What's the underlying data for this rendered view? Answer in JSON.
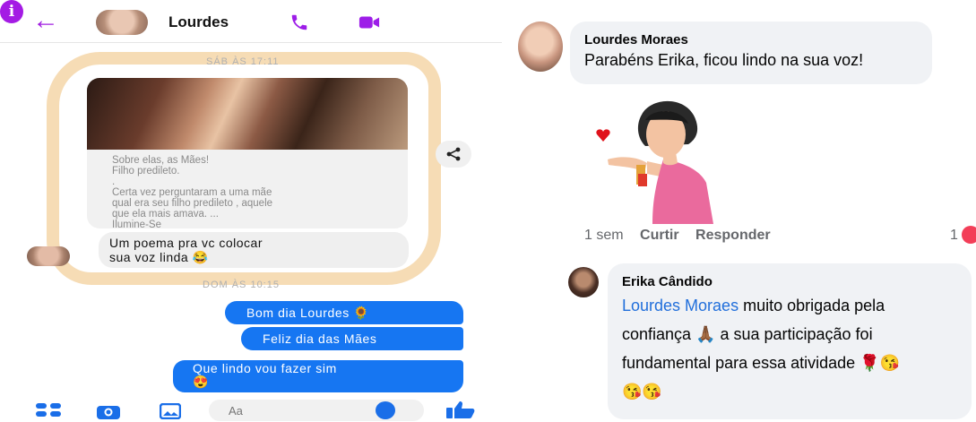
{
  "messenger": {
    "contact_name": "Lourdes",
    "timestamps": [
      "SÁB ÀS 17:11",
      "DOM ÀS 10:15"
    ],
    "shared_post": {
      "lines": [
        "Sobre elas, as Mães!",
        "Filho predileto.",
        ".",
        "Certa vez perguntaram a uma mãe",
        "qual era seu filho predileto , aquele",
        "que ela mais amava. ...",
        "Ilumine-Se"
      ]
    },
    "received_message": [
      "Um poema pra vc colocar",
      "sua voz linda 😂"
    ],
    "sent_messages": [
      "Bom dia Lourdes 🌻",
      "Feliz dia das Mães",
      "Que lindo vou fazer sim",
      "😍"
    ],
    "composer_placeholder": "Aa"
  },
  "comments": [
    {
      "author": "Lourdes Moraes",
      "text": "Parabéns Erika, ficou lindo na sua voz!",
      "time": "1 sem",
      "like_label": "Curtir",
      "reply_label": "Responder",
      "reactions": "1"
    },
    {
      "author": "Erika Cândido",
      "mention": "Lourdes Moraes",
      "text_lines": [
        " muito obrigada pela",
        "confiança 🙏🏾 a sua participação foi",
        "fundamental para essa atividade 🌹😘",
        "😘😘"
      ]
    }
  ],
  "colors": {
    "messenger_purple": "#9d1de8",
    "messenger_blue": "#1676f2",
    "fb_mention": "#216fdb",
    "highlight": "#f5d6a8"
  }
}
